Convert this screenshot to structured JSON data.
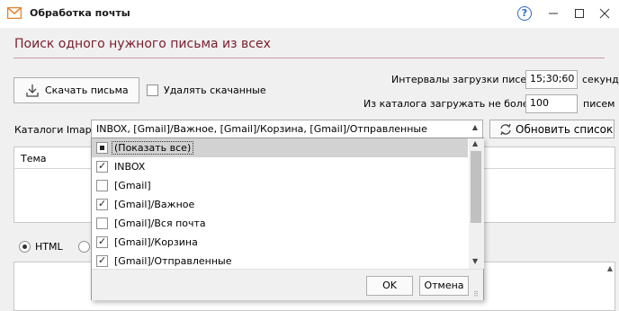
{
  "window": {
    "title": "Обработка почты",
    "help": "?"
  },
  "header": {
    "title": "Поиск одного нужного письма из всех"
  },
  "controls": {
    "download_label": "Скачать письма",
    "delete_downloaded_label": "Удалять скачанные",
    "intervals_label": "Интервалы загрузки писем:",
    "intervals_value": "15;30;60",
    "intervals_unit": "секунд",
    "max_load_label": "Из каталога загружать не более:",
    "max_load_value": "100",
    "max_load_unit": "писем",
    "imap_label": "Каталоги Imap:",
    "imap_value": "INBOX, [Gmail]/Важное, [Gmail]/Корзина, [Gmail]/Отправленные",
    "refresh_label": "Обновить список"
  },
  "grid": {
    "column_subject": "Тема"
  },
  "format": {
    "html_label": "HTML"
  },
  "dropdown": {
    "items": [
      {
        "label": "(Показать все)",
        "state": "partial"
      },
      {
        "label": "INBOX",
        "state": "checked"
      },
      {
        "label": "[Gmail]",
        "state": "unchecked"
      },
      {
        "label": "[Gmail]/Важное",
        "state": "checked"
      },
      {
        "label": "[Gmail]/Вся почта",
        "state": "unchecked"
      },
      {
        "label": "[Gmail]/Корзина",
        "state": "checked"
      },
      {
        "label": "[Gmail]/Отправленные",
        "state": "checked"
      }
    ],
    "ok_label": "OK",
    "cancel_label": "Отмена"
  },
  "colors": {
    "header_title": "#7a1d2c",
    "app_icon": "#e8822a",
    "help_icon": "#2b6cc4"
  },
  "icons": {
    "app": "envelope-icon",
    "download": "download-icon",
    "refresh": "refresh-icon"
  }
}
